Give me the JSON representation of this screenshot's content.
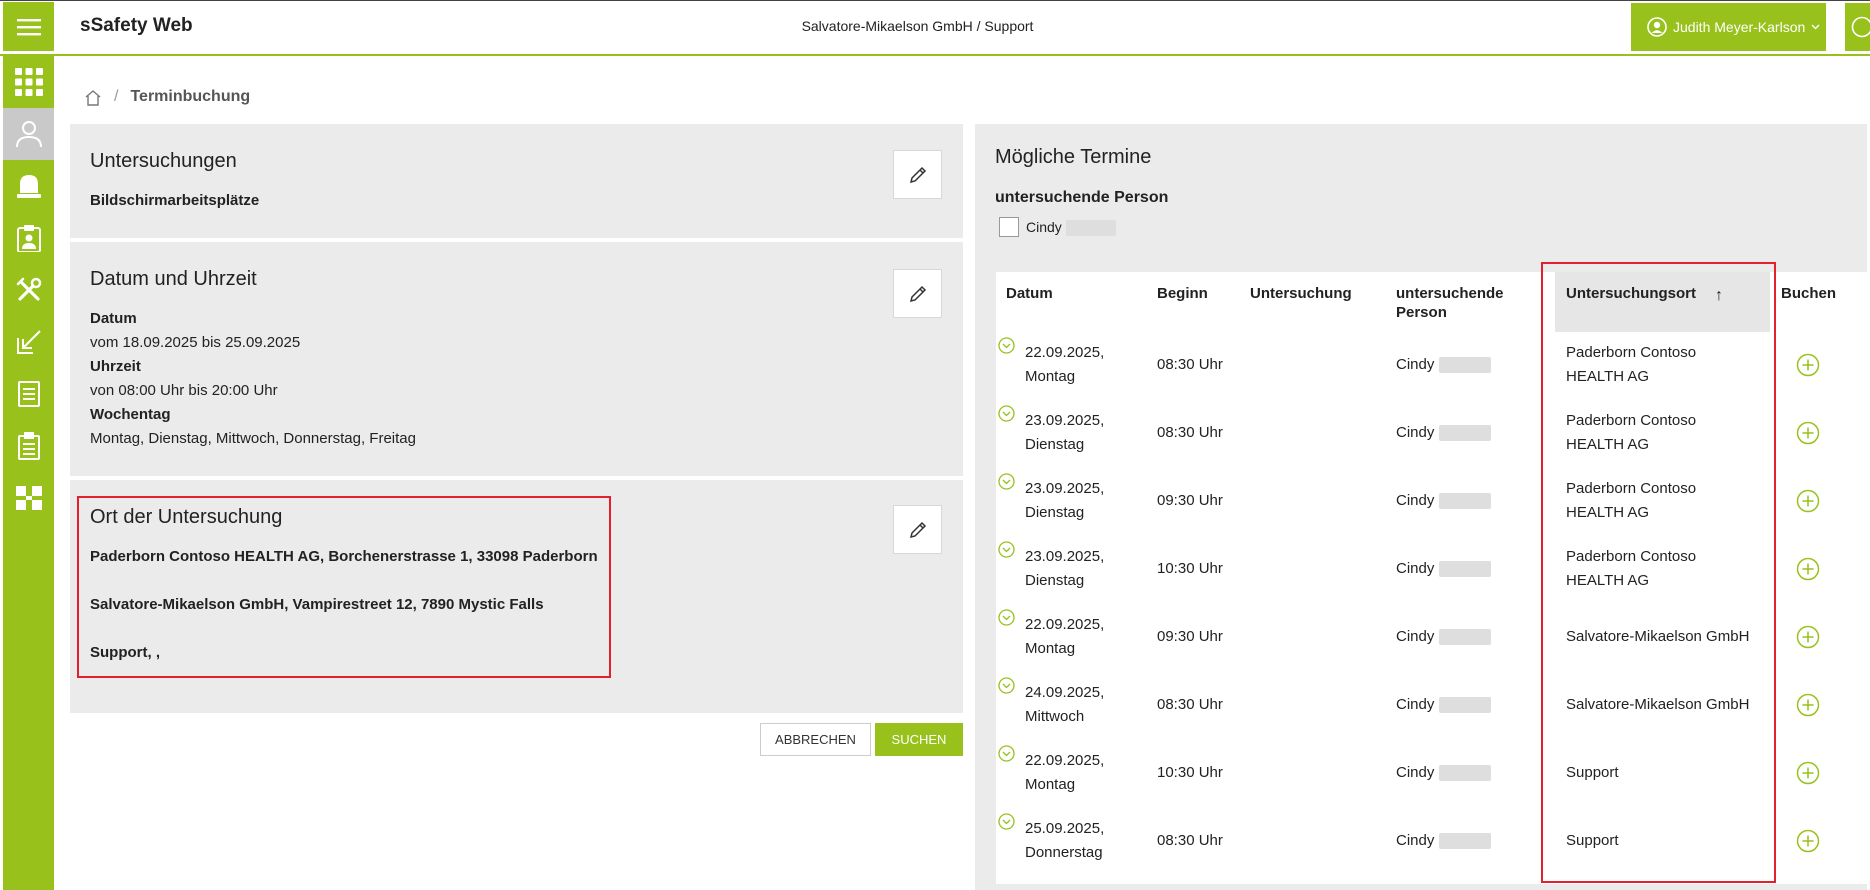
{
  "app": {
    "title": "sSafety Web",
    "context": "Salvatore-Mikaelson GmbH / Support",
    "user": "Judith Meyer-Karlson",
    "accent": "#98c11c",
    "highlight": "#e2202e"
  },
  "sidebar": {
    "items": [
      {
        "name": "apps-grid-icon"
      },
      {
        "name": "person-icon",
        "active": true
      },
      {
        "name": "bell-icon"
      },
      {
        "name": "clipboard-user-icon"
      },
      {
        "name": "tools-icon"
      },
      {
        "name": "arrow-in-icon"
      },
      {
        "name": "document-icon"
      },
      {
        "name": "checklist-icon"
      },
      {
        "name": "org-chart-icon"
      }
    ]
  },
  "breadcrumb": {
    "current": "Terminbuchung"
  },
  "untersuchungen": {
    "title": "Untersuchungen",
    "value": "Bildschirmarbeitsplätze"
  },
  "datum": {
    "title": "Datum und Uhrzeit",
    "datum_label": "Datum",
    "datum_value": "vom 18.09.2025 bis 25.09.2025",
    "uhrzeit_label": "Uhrzeit",
    "uhrzeit_value": "von 08:00 Uhr bis 20:00 Uhr",
    "wochentag_label": "Wochentag",
    "wochentag_value": "Montag, Dienstag, Mittwoch, Donnerstag, Freitag"
  },
  "ort": {
    "title": "Ort der Untersuchung",
    "lines": [
      "Paderborn Contoso HEALTH AG, Borchenerstrasse 1, 33098 Paderborn",
      "Salvatore-Mikaelson GmbH, Vampirestreet 12, 7890 Mystic Falls",
      "Support, ,"
    ]
  },
  "buttons": {
    "cancel": "ABBRECHEN",
    "search": "SUCHEN"
  },
  "termine": {
    "title": "Mögliche Termine",
    "person_label": "untersuchende Person",
    "person_checkbox": "Cindy",
    "columns": [
      "Datum",
      "Beginn",
      "Untersuchung",
      "untersuchende Person",
      "Untersuchungsort",
      "Buchen"
    ],
    "sort_indicator": "↑",
    "rows": [
      {
        "datum": "22.09.2025,",
        "tag": "Montag",
        "beginn": "08:30 Uhr",
        "person": "Cindy",
        "ort1": "Paderborn Contoso",
        "ort2": "HEALTH AG"
      },
      {
        "datum": "23.09.2025,",
        "tag": "Dienstag",
        "beginn": "08:30 Uhr",
        "person": "Cindy",
        "ort1": "Paderborn Contoso",
        "ort2": "HEALTH AG"
      },
      {
        "datum": "23.09.2025,",
        "tag": "Dienstag",
        "beginn": "09:30 Uhr",
        "person": "Cindy",
        "ort1": "Paderborn Contoso",
        "ort2": "HEALTH AG"
      },
      {
        "datum": "23.09.2025,",
        "tag": "Dienstag",
        "beginn": "10:30 Uhr",
        "person": "Cindy",
        "ort1": "Paderborn Contoso",
        "ort2": "HEALTH AG"
      },
      {
        "datum": "22.09.2025,",
        "tag": "Montag",
        "beginn": "09:30 Uhr",
        "person": "Cindy",
        "ort1": "Salvatore-Mikaelson GmbH",
        "ort2": ""
      },
      {
        "datum": "24.09.2025,",
        "tag": "Mittwoch",
        "beginn": "08:30 Uhr",
        "person": "Cindy",
        "ort1": "Salvatore-Mikaelson GmbH",
        "ort2": ""
      },
      {
        "datum": "22.09.2025,",
        "tag": "Montag",
        "beginn": "10:30 Uhr",
        "person": "Cindy",
        "ort1": "Support",
        "ort2": ""
      },
      {
        "datum": "25.09.2025,",
        "tag": "Donnerstag",
        "beginn": "08:30 Uhr",
        "person": "Cindy",
        "ort1": "Support",
        "ort2": ""
      }
    ]
  }
}
